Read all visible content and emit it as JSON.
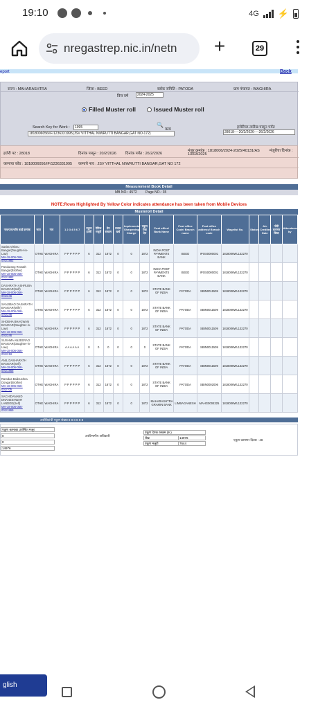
{
  "status": {
    "time": "19:10",
    "network": "4G"
  },
  "browser": {
    "url": "nregastrep.nic.in/netn",
    "tab_count": "29"
  },
  "report": {
    "report_label": "eport",
    "back_label": "Back"
  },
  "header": {
    "state_label": "राज्य : MAHARASHTRA",
    "district_label": "जिला : BEED",
    "block_label": "ब्लॉक समिति : PATODA",
    "gp_label": "ग्राम पंचायत : WAGHIRA",
    "fy_label": "वित्त वर्ष",
    "fy_value": "2024-2025",
    "filled_label": "Filled Muster roll",
    "issued_label": "Issued Muster roll",
    "search_label": "Search Key for Work :",
    "search_value": "1995",
    "work_label": "काम",
    "work_value": "1818006056/IF/1236331995(JSV VITTHAL NIWRUTTI BANGAR,GAT NO-172)",
    "mr_label": "हजेरीपट तारीख पासून पर्यंत",
    "mr_value": "28018----20/2/2026----26/2/2026"
  },
  "info": {
    "mr_no": "हजेरी पट : 28018",
    "from_date": "दिनांक पासून : 20/2/2026",
    "to_date": "दिनांक पर्यंत : 26/2/2026",
    "sanction_no": "मंजूर क्रमांक : 1818006/2024-2025/40131/AS",
    "sanction_date": "13/03/2025",
    "sanction_label": "मंजूरीचा दिनांक :",
    "work_code": "कामाचा कोड : 1818006056/IF/1236331995",
    "work_name": "कामाचे नाव : JSV VITTHAL NIWRUTTI BANGAR,GAT NO 172"
  },
  "mb": {
    "title": "Measurement Book Detail",
    "mb_no": "MB NO.: 4572",
    "page_no": "Page NO.: 35"
  },
  "note": "NOTE:Rows Highlighted By Yellow Color indicates attendance has been taken from Mobile Devices",
  "muster_title": "Musteroll Detail",
  "columns": [
    "नाव/पत्ता/जॉब कार्ड क्रमांक",
    "जात",
    "गाव",
    "1 2 3 4 5 6 7",
    "एकूण हजेरी",
    "दैनिक मजुरी",
    "देय रक्कम",
    "प्रवास खर्च",
    "Implements/ Sharpening Charge",
    "एकूण रोख देय",
    "Post office/ Bank Name",
    "Post office Code/ Branch name",
    "Post office address/ Branch code",
    "Wagelist No.",
    "Status",
    "A/c Credited Date",
    "नोंदी करणार किंवा",
    "Attendance by"
  ],
  "rows": [
    {
      "name": "Savita Vishnu Bangar(Daughter-in-Law)",
      "jc": "MH-18-006-056-001/1882",
      "caste": "OTHER",
      "village": "WAGHIRA",
      "att": "P P P P P P",
      "days": "6",
      "wage": "312",
      "due": "1872",
      "travel": "0",
      "impl": "0",
      "total": "1872",
      "bank": "INDIA POST PAYMENTS BANK",
      "branch": "BEED",
      "code": "IPOS0000001",
      "wagelist": "1818006WL132270"
    },
    {
      "name": "Pandurang Rewath Bangar(Brother)",
      "jc": "MH-18-006-056-001/1882",
      "caste": "OTHER",
      "village": "WAGHIRA",
      "att": "P P P P P P",
      "days": "6",
      "wage": "312",
      "due": "1872",
      "travel": "0",
      "impl": "0",
      "total": "1872",
      "bank": "INDIA POST PAYMENTS BANK",
      "branch": "BEED",
      "code": "IPOS0000001",
      "wagelist": "1818006WL132270"
    },
    {
      "name": "DASHRATH ASHRUBA BANGAR(Self)",
      "jc": "MH-18-006-056-001/246",
      "caste": "OTHER",
      "village": "WAGHIRA",
      "att": "P P P P P P",
      "days": "6",
      "wage": "312",
      "due": "1872",
      "travel": "0",
      "impl": "0",
      "total": "1872",
      "bank": "STATE BANK OF INDIA",
      "branch": "PATODA",
      "code": "SBIN0011509",
      "wagelist": "1818006WL132270"
    },
    {
      "name": "SANJIBAO DASHRATH BANGAR(Wife)",
      "jc": "MH-18-006-056-001/246",
      "caste": "OTHER",
      "village": "WAGHIRA",
      "att": "P P P P P P",
      "days": "6",
      "wage": "312",
      "due": "1872",
      "travel": "0",
      "impl": "0",
      "total": "1872",
      "bank": "STATE BANK OF INDIA",
      "branch": "PATODA",
      "code": "SBIN0011509",
      "wagelist": "1818006WL132270"
    },
    {
      "name": "SHOBHA BHAGWAN BANGAR(Daughter-in-Law)",
      "jc": "MH-18-006-056-001/246",
      "caste": "OTHER",
      "village": "WAGHIRA",
      "att": "P P P P P P",
      "days": "6",
      "wage": "312",
      "due": "1872",
      "travel": "0",
      "impl": "0",
      "total": "1872",
      "bank": "STATE BANK OF INDIA",
      "branch": "PATODA",
      "code": "SBIN0011509",
      "wagelist": "1818006WL132270"
    },
    {
      "name": "SUSHMA ANJEERAO BANGAR(Daughter-in-Law)",
      "jc": "MH-18-006-056-001/218",
      "caste": "OTHER",
      "village": "WAGHIRA",
      "att": "A A A A A A",
      "days": "0",
      "wage": "0",
      "due": "0",
      "travel": "0",
      "impl": "0",
      "total": "0",
      "bank": "STATE BANK OF INDIA",
      "branch": "PATODA",
      "code": "SBIN0011509",
      "wagelist": "1818006WL132270"
    },
    {
      "name": "ANIL DASHARATH BANGAR(Self)",
      "jc": "MH-18-006-056-001/1868",
      "caste": "OTHER",
      "village": "WAGHIRA",
      "att": "P P P P P P",
      "days": "6",
      "wage": "312",
      "due": "1872",
      "travel": "0",
      "impl": "0",
      "total": "1872",
      "bank": "STATE BANK OF INDIA",
      "branch": "PATODA",
      "code": "SBIN0011509",
      "wagelist": "1818006WL132270"
    },
    {
      "name": "Ramdas Balkrushna Dongar(Brother)",
      "jc": "MH-18-006-056-001/705",
      "caste": "OTHER",
      "village": "WAGHIRA",
      "att": "P P P P P P",
      "days": "6",
      "wage": "312",
      "due": "1872",
      "travel": "0",
      "impl": "0",
      "total": "1872",
      "bank": "STATE BANK OF INDIA",
      "branch": "PATODA",
      "code": "SBIN0002006",
      "wagelist": "1818006WL132270"
    },
    {
      "name": "SACHIDANAND DNANESHWAR LANDGE(Self)",
      "jc": "MH-18-006-056-001/1869",
      "caste": "OTHER",
      "village": "WAGHIRA",
      "att": "P P P P P P",
      "days": "6",
      "wage": "312",
      "due": "1872",
      "travel": "0",
      "impl": "0",
      "total": "1872",
      "bank": "MAHARASHTRA GRAMIN BANK",
      "branch": "LIMBAGANESH",
      "code": "MAHG0004325",
      "wagelist": "1818006WL132270"
    }
  ],
  "attendance_row": "उपस्थितांची एकूण संख्या  8 8 8 8 8 8",
  "footer": {
    "total_label": "एकूण कामावर उपस्थित मजूर",
    "officer_label": "उपविभागीय अधिकारी",
    "paid_label": "एकूण देयक रक्कम (रु.)",
    "cash_label": "रोख",
    "cash_value": "14976",
    "total_value_label": "एकूण मजुरी",
    "total_value": "7644",
    "attendance_label": "एकूण कामगार दिवस : 48",
    "sum_value": "14976",
    "zero1": "0",
    "zero2": "0"
  },
  "lang_button": "glish"
}
